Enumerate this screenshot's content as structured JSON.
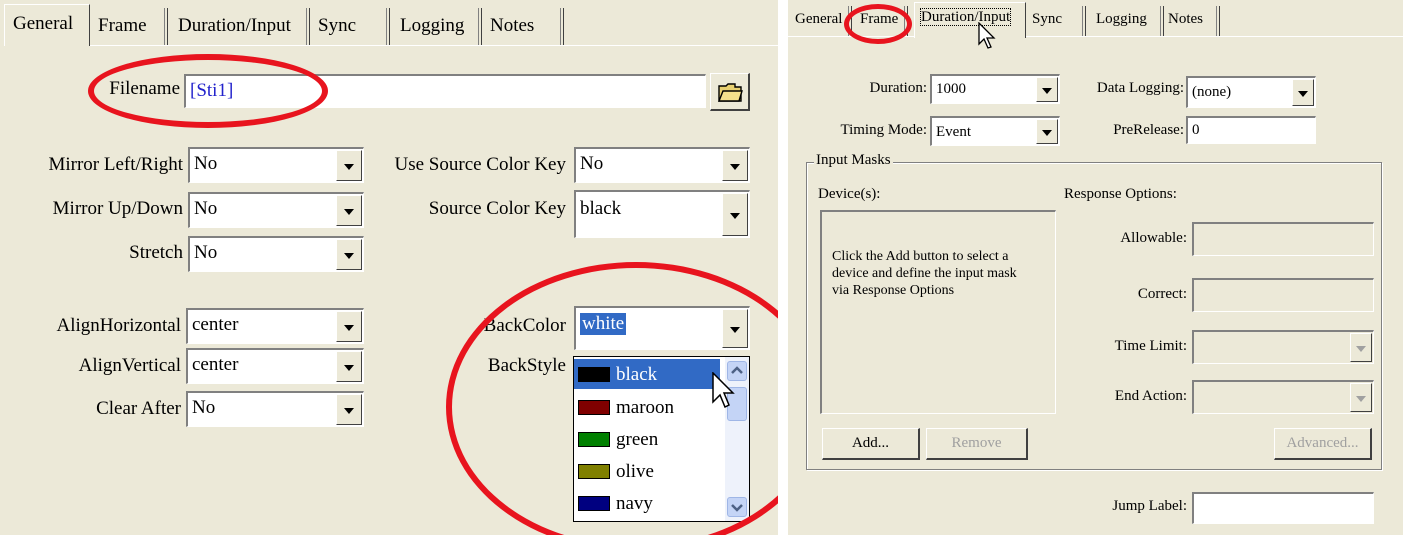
{
  "left_dialog": {
    "tabs": [
      "General",
      "Frame",
      "Duration/Input",
      "Sync",
      "Logging",
      "Notes"
    ],
    "filename": {
      "label": "Filename",
      "value": "[Sti1]"
    },
    "mirror_lr": {
      "label": "Mirror Left/Right",
      "value": "No"
    },
    "mirror_ud": {
      "label": "Mirror Up/Down",
      "value": "No"
    },
    "stretch": {
      "label": "Stretch",
      "value": "No"
    },
    "use_source_color_key": {
      "label": "Use Source Color Key",
      "value": "No"
    },
    "source_color_key": {
      "label": "Source Color Key",
      "value": "black"
    },
    "align_h": {
      "label": "AlignHorizontal",
      "value": "center"
    },
    "align_v": {
      "label": "AlignVertical",
      "value": "center"
    },
    "clear_after": {
      "label": "Clear After",
      "value": "No"
    },
    "back_color": {
      "label": "BackColor",
      "value": "white"
    },
    "back_style": {
      "label": "BackStyle"
    },
    "color_options": [
      {
        "name": "black",
        "color": "#000000"
      },
      {
        "name": "maroon",
        "color": "#800000"
      },
      {
        "name": "green",
        "color": "#008000"
      },
      {
        "name": "olive",
        "color": "#808000"
      },
      {
        "name": "navy",
        "color": "#000080"
      }
    ]
  },
  "right_dialog": {
    "tabs": [
      "General",
      "Frame",
      "Duration/Input",
      "Sync",
      "Logging",
      "Notes"
    ],
    "duration": {
      "label": "Duration:",
      "value": "1000"
    },
    "timing_mode": {
      "label": "Timing Mode:",
      "value": "Event"
    },
    "data_logging": {
      "label": "Data Logging:",
      "value": "(none)"
    },
    "prerelease": {
      "label": "PreRelease:",
      "value": "0"
    },
    "input_masks": {
      "title": "Input Masks",
      "devices_label": "Device(s):",
      "response_options_label": "Response Options:",
      "info_text": "Click the Add button to select a device and define the input mask via Response Options",
      "allowable_label": "Allowable:",
      "correct_label": "Correct:",
      "time_limit_label": "Time Limit:",
      "end_action_label": "End Action:",
      "add_button": "Add...",
      "remove_button": "Remove",
      "advanced_button": "Advanced..."
    },
    "jump_label": {
      "label": "Jump Label:",
      "value": ""
    }
  },
  "colors": {
    "highlight_ellipse": "#e8141e",
    "selection": "#316ac5",
    "dialog_bg": "#ece9d8"
  }
}
